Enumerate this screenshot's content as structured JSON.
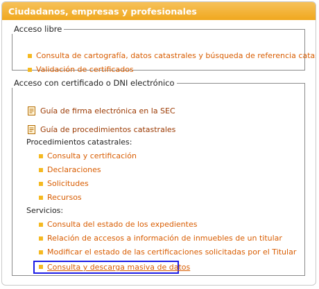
{
  "header": {
    "title": "Ciudadanos, empresas y profesionales"
  },
  "acceso_libre": {
    "legend": "Acceso libre",
    "items": [
      {
        "label": "Consulta de cartografía, datos catastrales y búsqueda de referencia catastral"
      },
      {
        "label": "Validación de certificados"
      }
    ]
  },
  "acceso_certificado": {
    "legend": "Acceso con certificado o DNI electrónico",
    "guides": [
      {
        "label": "Guía de firma electrónica en la SEC",
        "icon": "document-icon"
      },
      {
        "label": "Guía de procedimientos catastrales",
        "icon": "document-icon"
      }
    ],
    "procedimientos": {
      "heading": "Procedimientos catastrales:",
      "items": [
        {
          "label": "Consulta y certificación"
        },
        {
          "label": "Declaraciones"
        },
        {
          "label": "Solicitudes"
        },
        {
          "label": "Recursos"
        }
      ]
    },
    "servicios": {
      "heading": "Servicios:",
      "items": [
        {
          "label": "Consulta del estado de los expedientes"
        },
        {
          "label": "Relación de accesos a información de inmuebles de un titular"
        },
        {
          "label": "Modificar el estado de las certificaciones solicitadas por el Titular"
        },
        {
          "label": "Consulta y descarga masiva de datos",
          "selected": true
        }
      ]
    }
  },
  "colors": {
    "header": "#f0a81e",
    "link": "#d85c00",
    "bullet": "#f5b921",
    "focus": "#1a1ae6"
  }
}
